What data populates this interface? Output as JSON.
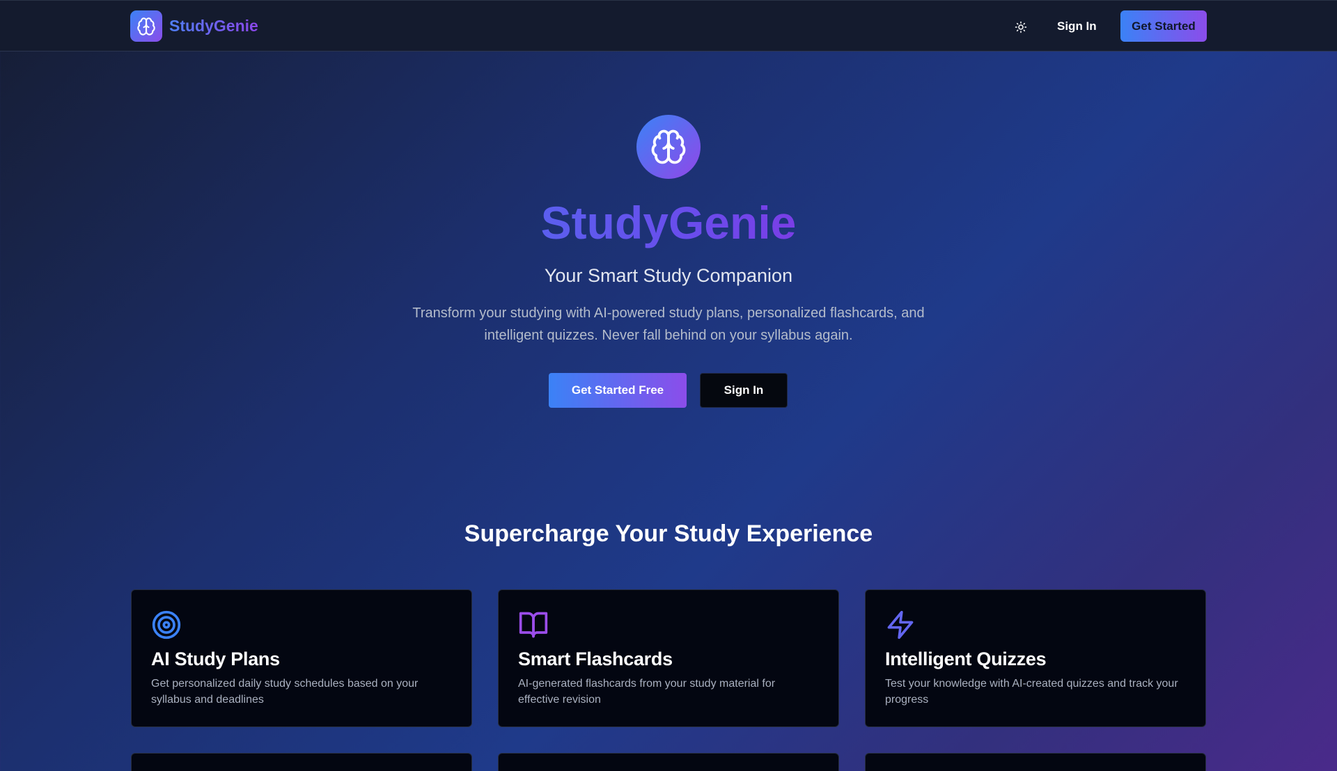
{
  "navbar": {
    "brand_name": "StudyGenie",
    "sign_in_label": "Sign In",
    "get_started_label": "Get Started"
  },
  "hero": {
    "title": "StudyGenie",
    "subtitle": "Your Smart Study Companion",
    "description": "Transform your studying with AI-powered study plans, personalized flashcards, and intelligent quizzes. Never fall behind on your syllabus again.",
    "primary_cta": "Get Started Free",
    "secondary_cta": "Sign In"
  },
  "features": {
    "heading": "Supercharge Your Study Experience",
    "cards": [
      {
        "icon": "target-icon",
        "title": "AI Study Plans",
        "description": "Get personalized daily study schedules based on your syllabus and deadlines"
      },
      {
        "icon": "book-open-icon",
        "title": "Smart Flashcards",
        "description": "AI-generated flashcards from your study material for effective revision"
      },
      {
        "icon": "lightning-icon",
        "title": "Intelligent Quizzes",
        "description": "Test your knowledge with AI-created quizzes and track your progress"
      }
    ]
  },
  "colors": {
    "accent_blue": "#3b82f6",
    "accent_purple": "#8b4dea",
    "card_background": "#030611"
  }
}
